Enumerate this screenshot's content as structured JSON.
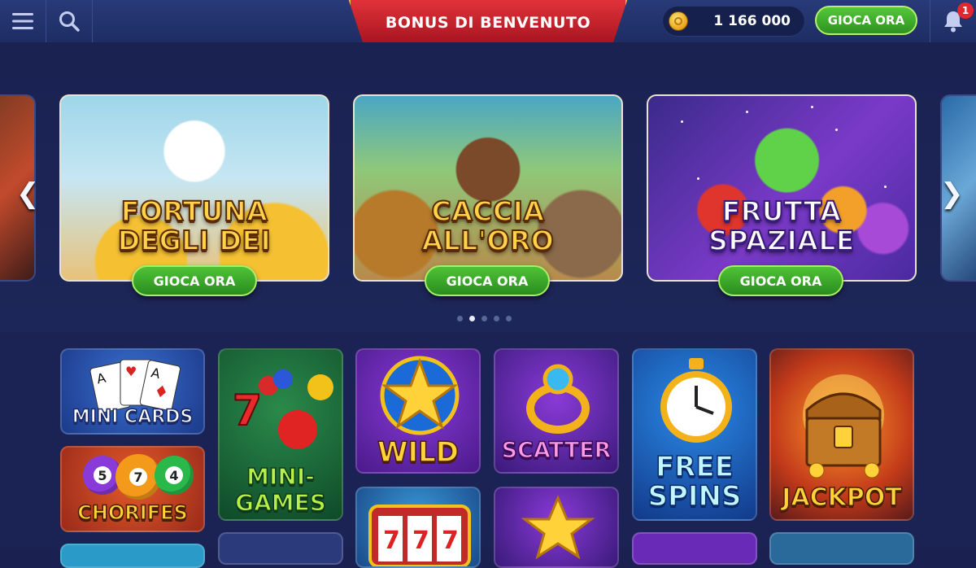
{
  "header": {
    "banner_label": "BONUS DI BENVENUTO",
    "balance": "1 166 000",
    "play_label": "GIOCA ORA",
    "notification_count": "1",
    "icons": {
      "menu": "menu-icon",
      "search": "search-icon",
      "coin": "coin-icon",
      "bell": "bell-icon"
    }
  },
  "carousel": {
    "slides": [
      {
        "title_line1": "FORTUNA",
        "title_line2": "DEGLI DEI",
        "button": "GIOCA ORA"
      },
      {
        "title_line1": "CACCIA",
        "title_line2": "ALL'ORO",
        "button": "GIOCA ORA"
      },
      {
        "title_line1": "FRUTTA",
        "title_line2": "SPAZIALE",
        "button": "GIOCA ORA"
      }
    ],
    "dot_count": 5,
    "active_dot": 1
  },
  "tiles": {
    "mini_cards": "MINI CARDS",
    "chorifes": "CHORIFES",
    "mini_games_line1": "MINI-",
    "mini_games_line2": "GAMES",
    "wild": "WILD",
    "scatter": "SCATTER",
    "free_spins_line1": "FREE",
    "free_spins_line2": "SPINS",
    "jackpot": "JACKPOT",
    "bingo_numbers": [
      "5",
      "7",
      "4"
    ]
  },
  "colors": {
    "accent_green": "#3fae2c",
    "banner_red": "#c81e2a",
    "background": "#1a2150",
    "gold": "#ffd23a"
  }
}
